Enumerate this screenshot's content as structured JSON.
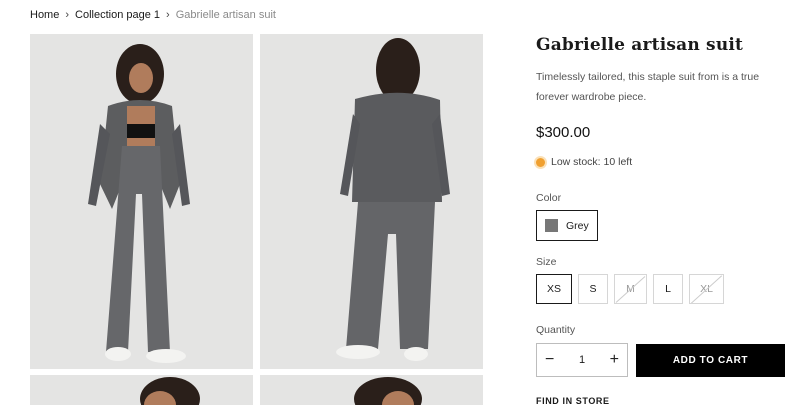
{
  "breadcrumb": {
    "home": "Home",
    "collection": "Collection page 1",
    "current": "Gabrielle artisan suit",
    "separator": "›"
  },
  "product": {
    "title": "Gabrielle artisan suit",
    "description": "Timelessly tailored, this staple suit from is a true forever wardrobe piece.",
    "price": "$300.00",
    "stock_label": "Low stock: 10 left",
    "stock_color": "#f0a030"
  },
  "color": {
    "label": "Color",
    "selected": "Grey",
    "swatch_hex": "#777777"
  },
  "size": {
    "label": "Size",
    "options": [
      {
        "label": "XS",
        "selected": true,
        "available": true
      },
      {
        "label": "S",
        "selected": false,
        "available": true
      },
      {
        "label": "M",
        "selected": false,
        "available": false
      },
      {
        "label": "L",
        "selected": false,
        "available": true
      },
      {
        "label": "XL",
        "selected": false,
        "available": false
      }
    ]
  },
  "quantity": {
    "label": "Quantity",
    "value": "1",
    "minus": "−",
    "plus": "+"
  },
  "actions": {
    "add_to_cart": "ADD TO CART",
    "find_in_store": "FIND IN STORE"
  }
}
